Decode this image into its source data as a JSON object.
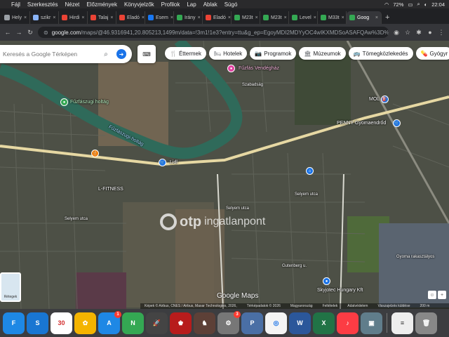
{
  "menubar": {
    "items": [
      "Fájl",
      "Szerkesztés",
      "Nézet",
      "Előzmények",
      "Könyvjelzők",
      "Profilok",
      "Lap",
      "Ablak",
      "Súgó"
    ],
    "battery": "72%",
    "time": "22:04"
  },
  "tabs": [
    {
      "label": "Hely",
      "color": "#9aa0a6"
    },
    {
      "label": "szikr",
      "color": "#8ab4f8"
    },
    {
      "label": "Hirdi",
      "color": "#ea4335"
    },
    {
      "label": "Talaj",
      "color": "#ea4335"
    },
    {
      "label": "Eladó",
      "color": "#ea4335"
    },
    {
      "label": "Esem",
      "color": "#1877f2"
    },
    {
      "label": "Irány",
      "color": "#34a853"
    },
    {
      "label": "Eladó",
      "color": "#ea4335"
    },
    {
      "label": "M23t",
      "color": "#34a853"
    },
    {
      "label": "M23t",
      "color": "#34a853"
    },
    {
      "label": "Level",
      "color": "#34a853"
    },
    {
      "label": "M33t",
      "color": "#34a853"
    },
    {
      "label": "Goog",
      "color": "#34a853"
    }
  ],
  "address": {
    "host": "google.com",
    "path": "/maps/@46.9316941,20.805213,1499m/data=!3m1!1e3?entry=ttu&g_ep=EgoyMDI2MDYyOC4wIKXMDSoASAFQAw%3D%3D"
  },
  "search": {
    "placeholder": "Keresés a Google Térképen"
  },
  "chips": [
    {
      "icon": "🍴",
      "label": "Éttermek"
    },
    {
      "icon": "🛏",
      "label": "Hotelek"
    },
    {
      "icon": "📷",
      "label": "Programok"
    },
    {
      "icon": "🏛",
      "label": "Múzeumok"
    },
    {
      "icon": "🚌",
      "label": "Tömegközlekedés"
    },
    {
      "icon": "💊",
      "label": "Gyógyr"
    }
  ],
  "map_labels": {
    "fuzfas": "Fűzfás Vendégház",
    "holtag": "Fűzfászugi holtág",
    "holtag_river": "Fűzfászugi-holtág",
    "mol": "MOL",
    "penny": "PENNY Gyomaendrőd",
    "lidl": "Lidl",
    "fitness": "L-FITNESS",
    "selyem1": "Selyem utca",
    "selyem2": "Selyem utca",
    "selyem3": "Selyem utca",
    "gutenberg": "Gutenberg u.",
    "gyoma": "Gyoma rakasztályos",
    "skyjotec": "Skyjotec Hungary Kft",
    "szabados": "Szabadság"
  },
  "watermark": {
    "brand": "otp",
    "sub": "ingatlanpont"
  },
  "google_logo": "Google Maps",
  "layer_thumb": "Rétegek",
  "attribution": [
    "Képek © Airbus, CNES / Airbus, Maxar Technologies, 2026,",
    "Térképadatok © 2026",
    "Magyarország",
    "Feltételek",
    "Adatvédelem",
    "Visszajelzés küldése",
    "200 m"
  ],
  "dock": [
    {
      "name": "finder",
      "label": "F",
      "color": "#1e88e5"
    },
    {
      "name": "safari",
      "label": "S",
      "color": "#1976d2"
    },
    {
      "name": "calendar",
      "label": "30",
      "color": "#ffffff"
    },
    {
      "name": "photos",
      "label": "✿",
      "color": "#f4b400"
    },
    {
      "name": "appstore",
      "label": "A",
      "color": "#1e88e5",
      "badge": "1"
    },
    {
      "name": "numbers",
      "label": "N",
      "color": "#34a853"
    },
    {
      "name": "launchpad",
      "label": "🚀",
      "color": "#444"
    },
    {
      "name": "game",
      "label": "♚",
      "color": "#b71c1c"
    },
    {
      "name": "chess",
      "label": "♞",
      "color": "#5d4037"
    },
    {
      "name": "settings",
      "label": "⚙",
      "color": "#777",
      "badge": "3"
    },
    {
      "name": "preview",
      "label": "P",
      "color": "#4a6fa5"
    },
    {
      "name": "chrome",
      "label": "◎",
      "color": "#f4f4f4"
    },
    {
      "name": "word",
      "label": "W",
      "color": "#2b579a"
    },
    {
      "name": "excel",
      "label": "X",
      "color": "#217346"
    },
    {
      "name": "music",
      "label": "♪",
      "color": "#fc3c44"
    },
    {
      "name": "photo-viewer",
      "label": "▣",
      "color": "#607d8b"
    },
    {
      "name": "notes",
      "label": "≡",
      "color": "#eee"
    },
    {
      "name": "trash",
      "label": "🗑",
      "color": "#888"
    }
  ]
}
